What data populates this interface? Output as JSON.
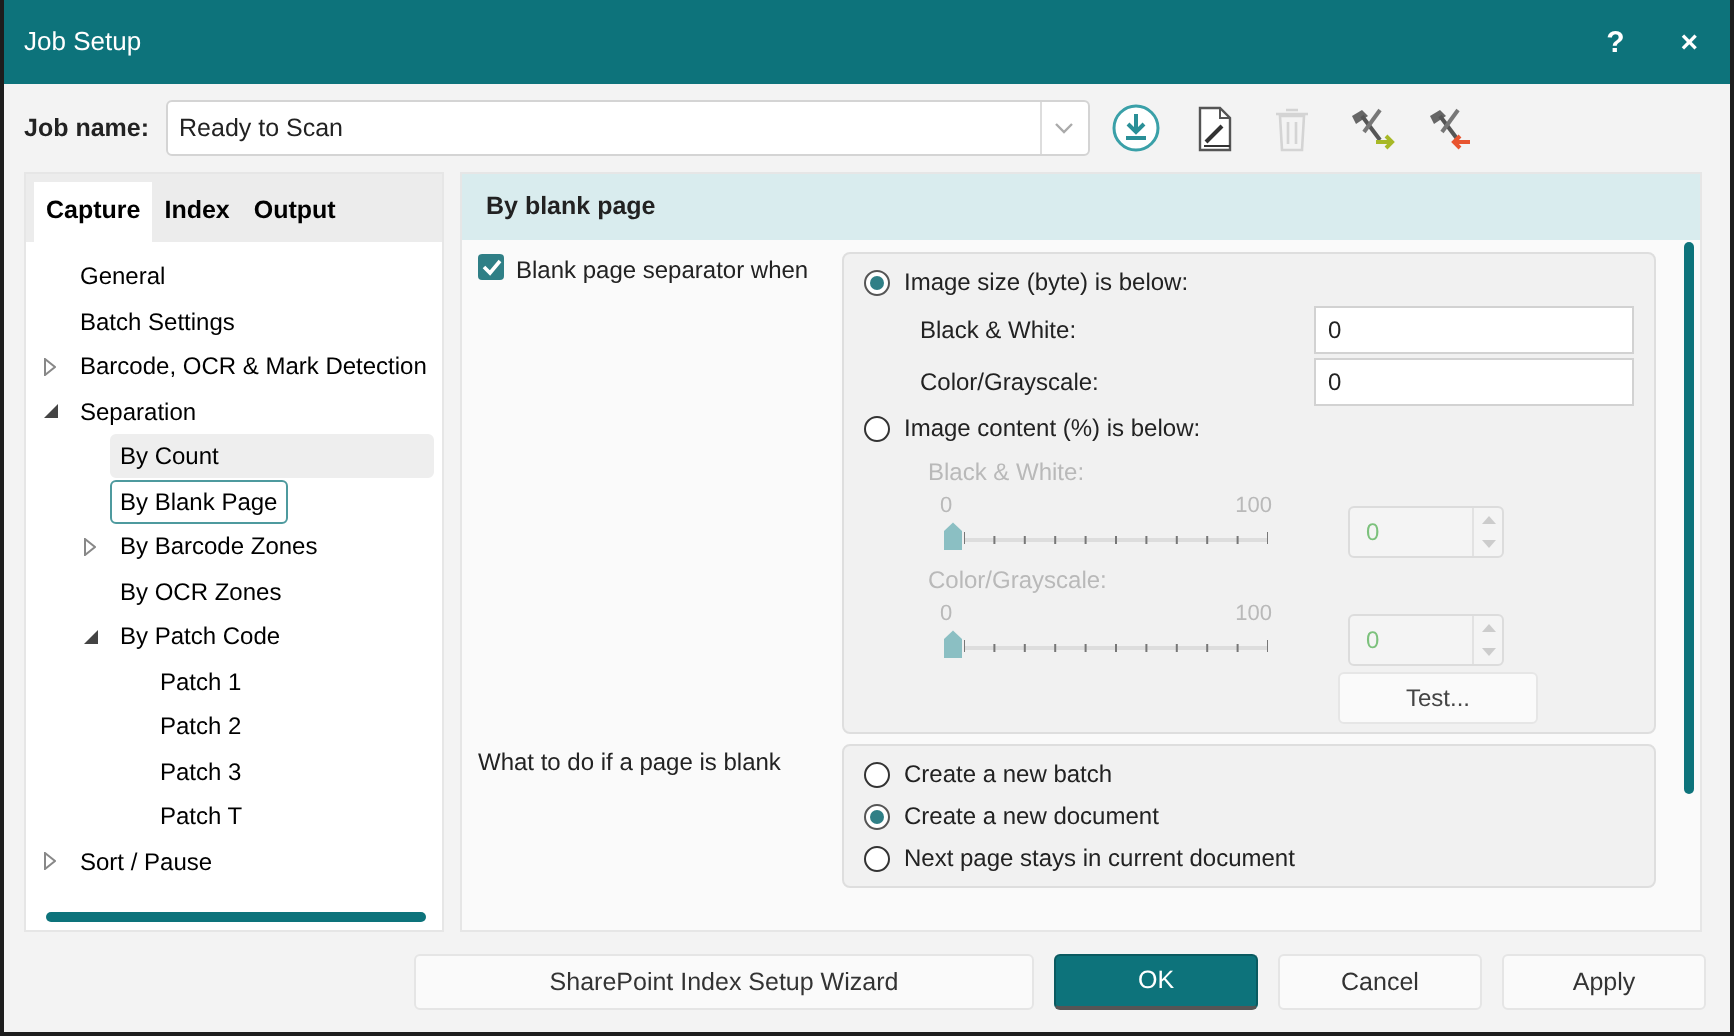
{
  "window": {
    "title": "Job Setup",
    "help_button": "?",
    "close_button": "×"
  },
  "job": {
    "label": "Job name:",
    "value": "Ready to Scan"
  },
  "toolbar": [
    {
      "kind": "import",
      "disabled": false
    },
    {
      "kind": "edit",
      "disabled": false
    },
    {
      "kind": "delete",
      "disabled": true
    },
    {
      "kind": "tools-in",
      "disabled": false
    },
    {
      "kind": "tools-out",
      "disabled": false
    }
  ],
  "tabs": [
    {
      "label": "Capture",
      "selected": true
    },
    {
      "label": "Index",
      "selected": false
    },
    {
      "label": "Output",
      "selected": false
    }
  ],
  "tree": [
    {
      "label": "General",
      "selected": false,
      "highlighted": false
    },
    {
      "label": "Batch Settings",
      "selected": false,
      "highlighted": false
    },
    {
      "label": "Barcode, OCR & Mark Detection",
      "selected": false,
      "highlighted": false,
      "expanded": false
    },
    {
      "label": "Separation",
      "selected": false,
      "highlighted": false,
      "expanded": true,
      "children": [
        {
          "label": "By Count",
          "selected": false,
          "highlighted": true
        },
        {
          "label": "By Blank Page",
          "selected": true,
          "highlighted": false
        },
        {
          "label": "By Barcode Zones",
          "selected": false,
          "highlighted": false,
          "expanded": false
        },
        {
          "label": "By OCR Zones",
          "selected": false,
          "highlighted": false
        },
        {
          "label": "By Patch Code",
          "selected": false,
          "highlighted": false,
          "expanded": true,
          "children": [
            {
              "label": "Patch 1",
              "selected": false,
              "highlighted": false
            },
            {
              "label": "Patch 2",
              "selected": false,
              "highlighted": false
            },
            {
              "label": "Patch 3",
              "selected": false,
              "highlighted": false
            },
            {
              "label": "Patch T",
              "selected": false,
              "highlighted": false
            }
          ]
        }
      ]
    },
    {
      "label": "Sort / Pause",
      "selected": false,
      "highlighted": false,
      "expanded": false
    }
  ],
  "panel": {
    "title": "By blank page",
    "separator": {
      "label": "Blank page separator when",
      "checked": true
    },
    "conditions": [
      {
        "label": "Image size (byte) is below:",
        "selected": true,
        "fields": [
          {
            "kind": "text",
            "label": "Black & White:",
            "value": "0",
            "disabled": false
          },
          {
            "kind": "text",
            "label": "Color/Grayscale:",
            "value": "0",
            "disabled": false
          }
        ]
      },
      {
        "label": "Image content (%) is below:",
        "selected": false,
        "fields": [
          {
            "kind": "slider",
            "label": "Black & White:",
            "min": "0",
            "max": "100",
            "level": 0,
            "value": "0",
            "disabled": true
          },
          {
            "kind": "slider",
            "label": "Color/Grayscale:",
            "min": "0",
            "max": "100",
            "level": 0,
            "value": "0",
            "disabled": true
          }
        ]
      }
    ],
    "test_button": "Test...",
    "action": {
      "label": "What to do if a page is blank",
      "options": [
        {
          "label": "Create a new batch",
          "selected": false
        },
        {
          "label": "Create a new document",
          "selected": true
        },
        {
          "label": "Next page stays in current document",
          "selected": false
        }
      ]
    }
  },
  "footer_buttons": [
    {
      "label": "SharePoint Index Setup Wizard",
      "primary": false
    },
    {
      "label": "OK",
      "primary": true
    },
    {
      "label": "Cancel",
      "primary": false
    },
    {
      "label": "Apply",
      "primary": false
    }
  ]
}
